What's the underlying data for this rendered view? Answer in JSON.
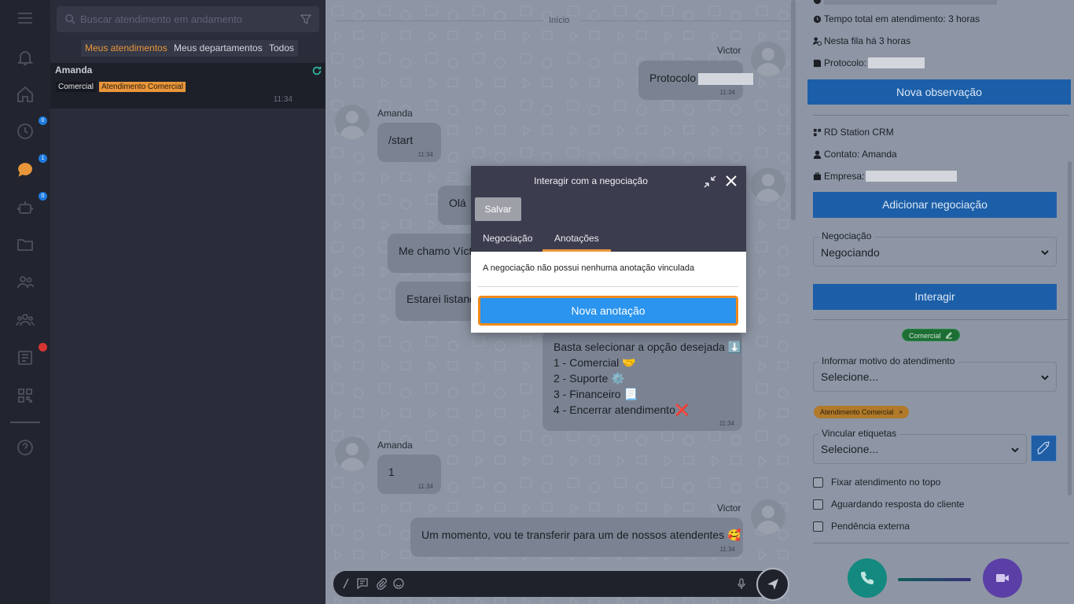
{
  "sidebar": {
    "items": [
      {
        "name": "menu",
        "icon": "menu-icon"
      },
      {
        "name": "notifications",
        "icon": "bell-icon"
      },
      {
        "name": "home",
        "icon": "home-icon"
      },
      {
        "name": "history",
        "icon": "clock-icon",
        "badge": "0"
      },
      {
        "name": "chats",
        "icon": "chat-icon",
        "badge": "1"
      },
      {
        "name": "bots",
        "icon": "robot-icon",
        "badge": "0"
      },
      {
        "name": "files",
        "icon": "folder-icon"
      },
      {
        "name": "contacts",
        "icon": "users-icon"
      },
      {
        "name": "groups",
        "icon": "group-icon"
      },
      {
        "name": "phonebook",
        "icon": "contacts-book-icon",
        "alert": true
      },
      {
        "name": "qrcode",
        "icon": "qrcode-icon"
      },
      {
        "name": "help",
        "icon": "help-icon"
      }
    ]
  },
  "list": {
    "search_placeholder": "Buscar atendimento em andamento",
    "filters": [
      "Meus atendimentos",
      "Meus departamentos",
      "Todos"
    ],
    "conversation": {
      "name": "Amanda",
      "tags": [
        "Comercial",
        "Atendimento Comercial"
      ],
      "time": "11:34"
    }
  },
  "chat": {
    "day_label": "Início",
    "messages": [
      {
        "sender": "Victor",
        "text": "Protocolo",
        "time": "11:34"
      },
      {
        "sender": "Amanda",
        "text": "/start",
        "time": "11:34"
      },
      {
        "text": "Olá"
      },
      {
        "text": "Me chamo Víct"
      },
      {
        "text": "Estarei listand"
      },
      {
        "lines": [
          "Basta selecionar a opção desejada ⬇️",
          "1 - Comercial 🤝",
          "2 - Suporte ⚙️",
          "3 - Financeiro 📃",
          "4 - Encerrar atendimento❌"
        ],
        "time": "11:34"
      },
      {
        "sender": "Amanda",
        "text": "1",
        "time": "11:34"
      },
      {
        "sender": "Victor",
        "text": "Um momento, vou te transferir para um de nossos atendentes 🥰",
        "time": "11:34"
      }
    ]
  },
  "right_panel": {
    "total_time": "Tempo total em atendimento: 3 horas",
    "queue_time": "Nesta fila há 3 horas",
    "protocol_label": "Protocolo:",
    "new_note_button": "Nova observação",
    "crm_title": "RD Station CRM",
    "contact": "Contato: Amanda",
    "company_label": "Empresa:",
    "add_deal_button": "Adicionar negociação",
    "deal_legend": "Negociação",
    "deal_value": "Negociando",
    "interact_button": "Interagir",
    "department_chip": "Comercial",
    "reason_legend": "Informar motivo do atendimento",
    "reason_value": "Selecione...",
    "tag_chip": "Atendimento Comercial",
    "labels_legend": "Vincular etiquetas",
    "labels_value": "Selecione...",
    "checkboxes": [
      "Fixar atendimento no topo",
      "Aguardando resposta do cliente",
      "Pendência externa"
    ]
  },
  "modal": {
    "title": "Interagir com a negociação",
    "save_button": "Salvar",
    "tabs": [
      "Negociação",
      "Anotações"
    ],
    "active_tab": "Anotações",
    "empty_message": "A negociação não possui nenhuma anotação vinculada",
    "new_note_button": "Nova anotação"
  },
  "colors": {
    "accent_orange": "#e9963a",
    "primary_blue": "#2a94ee",
    "sidebar_bg": "#22252f",
    "call_green": "#14897f",
    "video_purple": "#5b3fa6"
  }
}
